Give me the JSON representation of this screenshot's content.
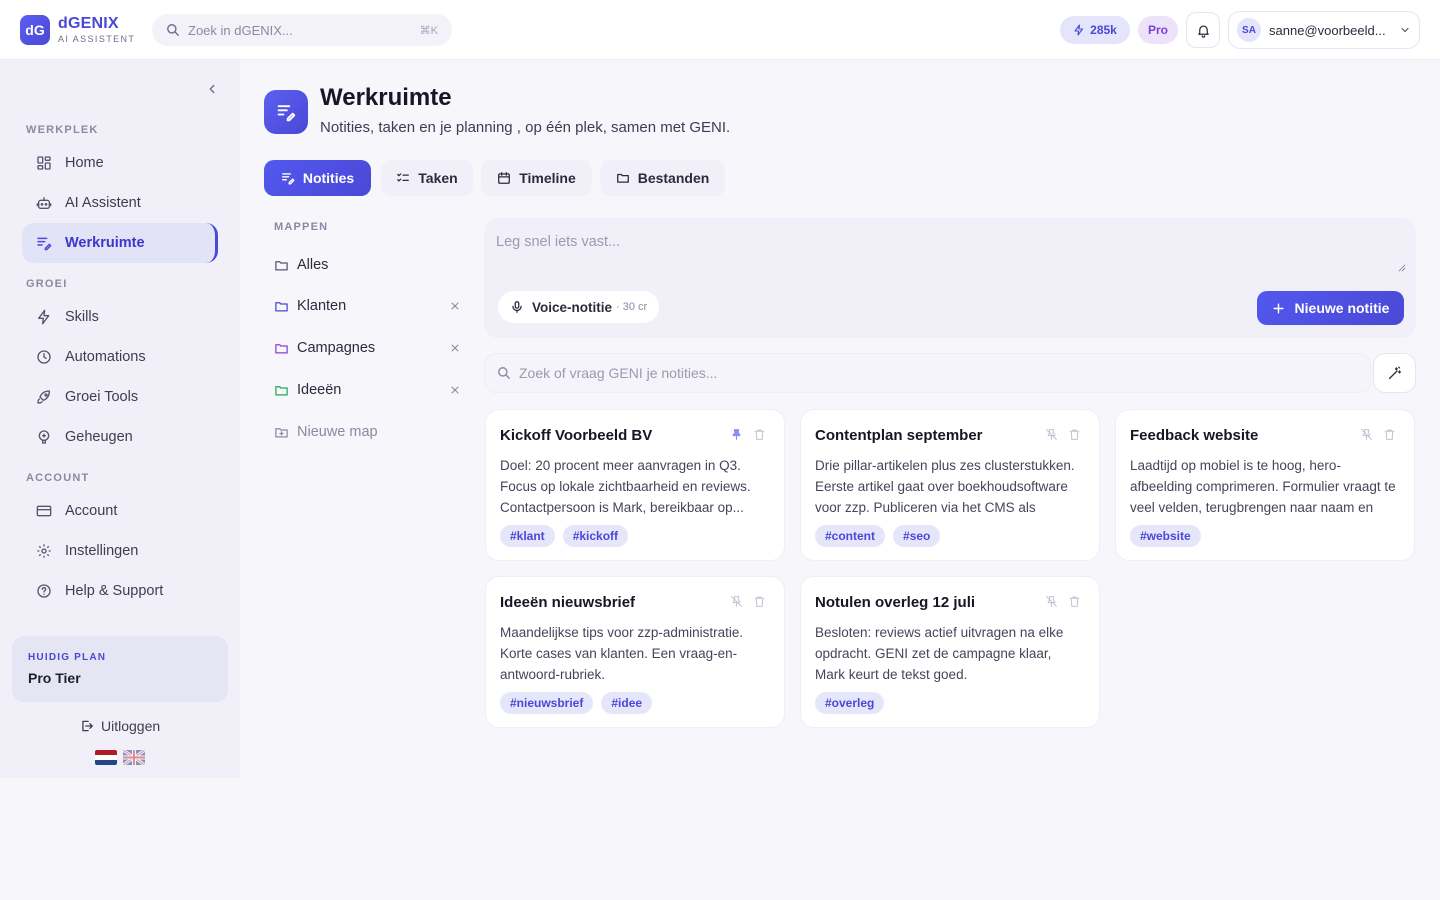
{
  "app": {
    "logo_badge": "dG",
    "name": "dGENIX",
    "subtitle": "AI ASSISTENT"
  },
  "topbar": {
    "search_placeholder": "Zoek in dGENIX...",
    "search_shortcut": "⌘K",
    "credits": "285k",
    "plan_badge": "Pro",
    "user_initials": "SA",
    "user_email": "sanne@voorbeeld..."
  },
  "sidebar": {
    "sections": [
      {
        "label": "WERKPLEK",
        "items": [
          {
            "label": "Home",
            "icon": "dashboard-icon"
          },
          {
            "label": "AI Assistent",
            "icon": "robot-icon"
          },
          {
            "label": "Werkruimte",
            "icon": "notes-edit-icon",
            "active": true
          }
        ]
      },
      {
        "label": "GROEI",
        "items": [
          {
            "label": "Skills",
            "icon": "lightning-icon"
          },
          {
            "label": "Automations",
            "icon": "clock-icon"
          },
          {
            "label": "Groei Tools",
            "icon": "rocket-icon"
          },
          {
            "label": "Geheugen",
            "icon": "brain-icon"
          }
        ]
      },
      {
        "label": "ACCOUNT",
        "items": [
          {
            "label": "Account",
            "icon": "credit-card-icon"
          },
          {
            "label": "Instellingen",
            "icon": "gear-icon"
          },
          {
            "label": "Help & Support",
            "icon": "help-icon"
          }
        ]
      }
    ],
    "plan": {
      "label": "HUIDIG PLAN",
      "value": "Pro Tier"
    },
    "logout": "Uitloggen",
    "languages": [
      "nl",
      "en"
    ]
  },
  "page": {
    "title": "Werkruimte",
    "subtitle": "Notities, taken en je planning , op één plek, samen met GENI."
  },
  "tabs": [
    {
      "label": "Notities",
      "active": true
    },
    {
      "label": "Taken"
    },
    {
      "label": "Timeline"
    },
    {
      "label": "Bestanden"
    }
  ],
  "folders": {
    "label": "MAPPEN",
    "items": [
      {
        "label": "Alles",
        "color": "#555570",
        "removable": false
      },
      {
        "label": "Klanten",
        "color": "#4a48d6",
        "removable": true
      },
      {
        "label": "Campagnes",
        "color": "#8b3fd6",
        "removable": true
      },
      {
        "label": "Ideeën",
        "color": "#22a55b",
        "removable": true
      }
    ],
    "new_label": "Nieuwe map"
  },
  "capture": {
    "placeholder": "Leg snel iets vast...",
    "voice_label": "Voice-notitie",
    "voice_cost": "· 30 cr",
    "new_note_label": "Nieuwe notitie"
  },
  "notes_search": {
    "placeholder": "Zoek of vraag GENI je notities..."
  },
  "notes": [
    {
      "title": "Kickoff Voorbeeld BV",
      "pinned": true,
      "body": "Doel: 20 procent meer aanvragen in Q3. Focus op lokale zichtbaarheid en reviews. Contactpersoon is Mark, bereikbaar op...",
      "tags": [
        "#klant",
        "#kickoff"
      ]
    },
    {
      "title": "Contentplan september",
      "pinned": false,
      "body": "Drie pillar-artikelen plus zes clusterstukken. Eerste artikel gaat over boekhoudsoftware voor zzp. Publiceren via het CMS als concept.",
      "tags": [
        "#content",
        "#seo"
      ]
    },
    {
      "title": "Feedback website",
      "pinned": false,
      "body": "Laadtijd op mobiel is te hoog, hero-afbeelding comprimeren. Formulier vraagt te veel velden, terugbrengen naar naam en e-...",
      "tags": [
        "#website"
      ]
    },
    {
      "title": "Ideeën nieuwsbrief",
      "pinned": false,
      "body": "Maandelijkse tips voor zzp-administratie. Korte cases van klanten. Een vraag-en-antwoord-rubriek.",
      "tags": [
        "#nieuwsbrief",
        "#idee"
      ]
    },
    {
      "title": "Notulen overleg 12 juli",
      "pinned": false,
      "body": "Besloten: reviews actief uitvragen na elke opdracht. GENI zet de campagne klaar, Mark keurt de tekst goed.",
      "tags": [
        "#overleg"
      ]
    }
  ],
  "colors": {
    "accent": "#4a48d6",
    "accent_light": "#e4e4fb",
    "pro_purple": "#7b3fd6"
  }
}
